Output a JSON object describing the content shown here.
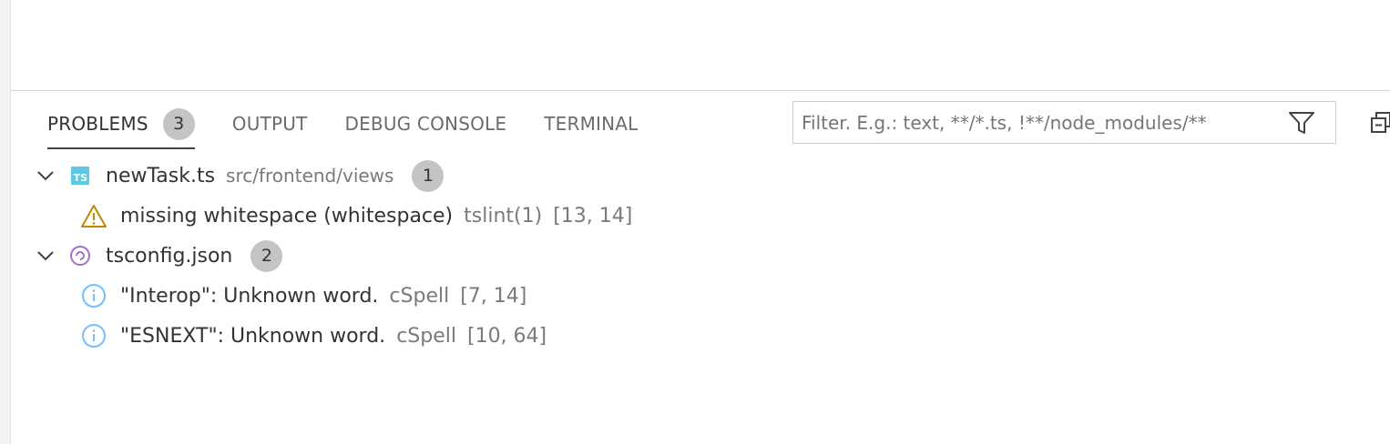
{
  "colors": {
    "accent_underline": "#424242",
    "warning": "#bf8803",
    "info": "#75beff",
    "ts_icon": "#5ec9e0",
    "json_icon": "#a074c4",
    "badge_bg": "#c4c4c4"
  },
  "panel": {
    "tabs": [
      {
        "label": "PROBLEMS",
        "badge": "3",
        "active": true
      },
      {
        "label": "OUTPUT",
        "active": false
      },
      {
        "label": "DEBUG CONSOLE",
        "active": false
      },
      {
        "label": "TERMINAL",
        "active": false
      }
    ],
    "filter": {
      "placeholder": "Filter. E.g.: text, **/*.ts, !**/node_modules/**",
      "value": "",
      "icon": "filter-icon"
    },
    "collapse_icon": "collapse-all-icon"
  },
  "problems": {
    "files": [
      {
        "name": "newTask.ts",
        "path": "src/frontend/views",
        "count": "1",
        "icon": "typescript-file-icon",
        "items": [
          {
            "severity": "warning",
            "message": "missing whitespace (whitespace)",
            "source": "tslint(1)",
            "position": "[13, 14]"
          }
        ]
      },
      {
        "name": "tsconfig.json",
        "path": "",
        "count": "2",
        "icon": "tsconfig-file-icon",
        "items": [
          {
            "severity": "info",
            "message": "\"Interop\": Unknown word.",
            "source": "cSpell",
            "position": "[7, 14]"
          },
          {
            "severity": "info",
            "message": "\"ESNEXT\": Unknown word.",
            "source": "cSpell",
            "position": "[10, 64]"
          }
        ]
      }
    ]
  }
}
